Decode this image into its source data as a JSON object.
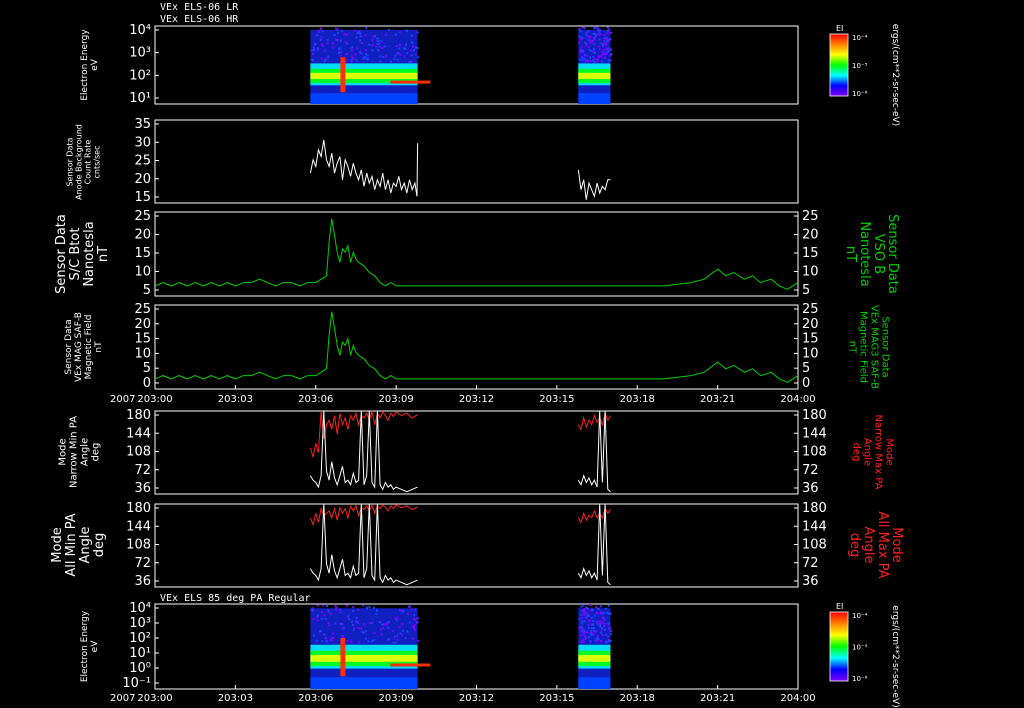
{
  "header": {
    "line1": "VEx ELS-06 LR",
    "line2": "VEx ELS-06 HR",
    "panel7_title": "VEx ELS 85 deg PA Regular"
  },
  "colorbar": {
    "label": "EI",
    "ticks": [
      "10⁻⁴",
      "10⁻⁵",
      "10⁻⁶"
    ],
    "units": "ergs/(cm**2-sr-sec-eV)",
    "colors": [
      "#ff0000",
      "#ff8000",
      "#ffff00",
      "#00ff00",
      "#00ffff",
      "#0000ff",
      "#8000ff"
    ]
  },
  "time_axis": {
    "year": "2007",
    "ticks": [
      "203:00",
      "203:03",
      "203:06",
      "203:09",
      "203:12",
      "203:15",
      "203:18",
      "203:21",
      "204:00"
    ]
  },
  "colors": {
    "green": "#00d000",
    "red": "#ff2020",
    "white": "#ffffff",
    "frame": "#ffffff"
  },
  "chart_data": [
    {
      "type": "heatmap",
      "ylabel": "Electron Energy eV",
      "yticks": [
        "10⁴",
        "10³",
        "10²",
        "10¹"
      ],
      "data_intervals": [
        [
          "203:05:48",
          "203:09:48"
        ],
        [
          "203:15:48",
          "203:17:00"
        ]
      ]
    },
    {
      "type": "line",
      "ylabel": "Sensor Data Anode Background Count Rate cnts/sec",
      "yticks": [
        "35",
        "30",
        "25",
        "20",
        "15"
      ],
      "ylim": [
        10,
        35
      ],
      "series": [
        {
          "color": "white",
          "x": [
            5.8,
            5.9,
            6.0,
            6.1,
            6.2,
            6.3,
            6.4,
            6.5,
            6.6,
            6.7,
            6.8,
            6.9,
            7.0,
            7.1,
            7.2,
            7.3,
            7.4,
            7.5,
            7.6,
            7.7,
            7.8,
            7.9,
            8.0,
            8.1,
            8.2,
            8.3,
            8.4,
            8.5,
            8.6,
            8.7,
            8.8,
            8.9,
            9.0,
            9.1,
            9.2,
            9.3,
            9.4,
            9.5,
            9.6,
            9.7,
            9.78,
            9.8
          ],
          "y": [
            19,
            23,
            21,
            26,
            24,
            29,
            23,
            21,
            25,
            19,
            22,
            24,
            17,
            23,
            21,
            18,
            22,
            19,
            17,
            20,
            15,
            19,
            16,
            18,
            14,
            17,
            15,
            19,
            14,
            17,
            13,
            16,
            15,
            18,
            14,
            16,
            13,
            17,
            14,
            16,
            12,
            28
          ]
        },
        {
          "color": "white",
          "x": [
            15.8,
            15.9,
            16.0,
            16.1,
            16.2,
            16.3,
            16.4,
            16.5,
            16.6,
            16.7,
            16.8,
            16.9,
            17.0
          ],
          "y": [
            20,
            14,
            17,
            11,
            16,
            14,
            12,
            16,
            13,
            15,
            14,
            17,
            17
          ]
        }
      ]
    },
    {
      "type": "line",
      "ylabel": "Sensor Data S/C Btot Nanotesla nT",
      "ylabel_right": "Sensor Data VSO B Nanotesla nT",
      "yticks": [
        "25",
        "20",
        "15",
        "10",
        "5"
      ],
      "ylim": [
        0,
        25
      ],
      "series": [
        {
          "color": "green",
          "x": [
            0,
            0.3,
            0.6,
            0.9,
            1.2,
            1.5,
            1.8,
            2.1,
            2.4,
            2.7,
            3.0,
            3.3,
            3.6,
            3.9,
            4.2,
            4.5,
            4.8,
            5.1,
            5.4,
            5.7,
            6.0,
            6.2,
            6.4,
            6.5,
            6.6,
            6.7,
            6.8,
            6.9,
            7.0,
            7.1,
            7.2,
            7.3,
            7.4,
            7.5,
            7.6,
            7.8,
            8.0,
            8.2,
            8.4,
            8.6,
            8.8,
            9.0,
            9.5,
            10,
            11,
            12,
            13,
            14,
            15,
            16,
            17,
            18,
            19,
            20,
            20.5,
            21,
            21.3,
            21.6,
            22,
            22.3,
            22.6,
            23,
            23.3,
            23.6,
            24
          ],
          "y": [
            3,
            4,
            3,
            4,
            3,
            4,
            3,
            4,
            3,
            4,
            3,
            4,
            4,
            5,
            4,
            3,
            4,
            4,
            3,
            4,
            4,
            5,
            6,
            16,
            23,
            18,
            13,
            10,
            14,
            13,
            15,
            10,
            13,
            11,
            10,
            9,
            7,
            6,
            4,
            3,
            4,
            3,
            3,
            3,
            3,
            3,
            3,
            3,
            3,
            3,
            3,
            3,
            3,
            4,
            5,
            8,
            6,
            7,
            5,
            6,
            4,
            5,
            3,
            2,
            4
          ]
        }
      ]
    },
    {
      "type": "line",
      "ylabel": "Sensor Data VEx MAG SAF-B Magnetic Field nT",
      "ylabel_right": "Sensor Data VEx MAG3 SAF-B Magnetic Field nT",
      "yticks": [
        "25",
        "20",
        "15",
        "10",
        "5",
        "0"
      ],
      "ylim": [
        0,
        25
      ],
      "series": [
        {
          "color": "green",
          "x": [
            0,
            0.3,
            0.6,
            0.9,
            1.2,
            1.5,
            1.8,
            2.1,
            2.4,
            2.7,
            3.0,
            3.3,
            3.6,
            3.9,
            4.2,
            4.5,
            4.8,
            5.1,
            5.4,
            5.7,
            6.0,
            6.2,
            6.4,
            6.5,
            6.6,
            6.7,
            6.8,
            6.9,
            7.0,
            7.1,
            7.2,
            7.3,
            7.4,
            7.5,
            7.6,
            7.8,
            8.0,
            8.2,
            8.4,
            8.6,
            8.8,
            9.0,
            9.5,
            10,
            11,
            12,
            13,
            14,
            15,
            16,
            17,
            18,
            19,
            20,
            20.5,
            21,
            21.3,
            21.6,
            22,
            22.3,
            22.6,
            23,
            23.3,
            23.6,
            24
          ],
          "y": [
            3,
            4,
            3,
            4,
            3,
            4,
            3,
            4,
            3,
            4,
            3,
            4,
            4,
            5,
            4,
            3,
            4,
            4,
            3,
            4,
            4,
            5,
            6,
            16,
            23,
            18,
            13,
            10,
            14,
            13,
            15,
            10,
            13,
            11,
            10,
            9,
            7,
            6,
            4,
            3,
            4,
            3,
            3,
            3,
            3,
            3,
            3,
            3,
            3,
            3,
            3,
            3,
            3,
            4,
            5,
            8,
            6,
            7,
            5,
            6,
            4,
            5,
            3,
            2,
            4
          ]
        }
      ]
    },
    {
      "type": "line",
      "ylabel": "Mode Narrow Min PA Angle deg",
      "ylabel_right": "Mode Narrow Max PA Angle deg",
      "yticks": [
        "180",
        "144",
        "108",
        "72",
        "36"
      ],
      "ylim": [
        0,
        180
      ],
      "series": [
        {
          "color": "red",
          "x": [
            5.8,
            5.9,
            6.0,
            6.1,
            6.2,
            6.3,
            6.4,
            6.5,
            6.6,
            6.7,
            6.8,
            6.9,
            7.0,
            7.1,
            7.2,
            7.3,
            7.4,
            7.5,
            7.6,
            7.7,
            7.8,
            7.9,
            8.0,
            8.1,
            8.2,
            8.3,
            8.4,
            8.5,
            8.6,
            8.7,
            8.8,
            8.9,
            9.0,
            9.2,
            9.4,
            9.6,
            9.8
          ],
          "y": [
            100,
            80,
            110,
            90,
            180,
            120,
            150,
            160,
            140,
            170,
            130,
            175,
            150,
            165,
            140,
            170,
            160,
            175,
            150,
            170,
            165,
            175,
            160,
            178,
            150,
            175,
            165,
            178,
            170,
            160,
            175,
            168,
            178,
            170,
            175,
            165,
            172
          ]
        },
        {
          "color": "white",
          "x": [
            5.8,
            5.9,
            6.0,
            6.1,
            6.2,
            6.3,
            6.4,
            6.5,
            6.6,
            6.7,
            6.8,
            6.9,
            7.0,
            7.1,
            7.2,
            7.3,
            7.4,
            7.5,
            7.6,
            7.7,
            7.8,
            7.9,
            8.0,
            8.1,
            8.2,
            8.3,
            8.4,
            8.5,
            8.6,
            8.7,
            8.8,
            8.9,
            9.0,
            9.2,
            9.4,
            9.6,
            9.8
          ],
          "y": [
            40,
            30,
            25,
            15,
            40,
            180,
            50,
            30,
            70,
            35,
            20,
            40,
            60,
            25,
            30,
            20,
            45,
            25,
            30,
            180,
            20,
            40,
            180,
            25,
            15,
            180,
            20,
            10,
            25,
            15,
            20,
            10,
            15,
            10,
            5,
            10,
            15
          ]
        },
        {
          "color": "red",
          "x": [
            15.8,
            15.9,
            16.0,
            16.1,
            16.2,
            16.3,
            16.4,
            16.5,
            16.6,
            16.7,
            16.8,
            16.9,
            17.0
          ],
          "y": [
            150,
            140,
            165,
            145,
            160,
            150,
            170,
            155,
            165,
            150,
            175,
            160,
            170
          ]
        },
        {
          "color": "white",
          "x": [
            15.8,
            15.9,
            16.0,
            16.1,
            16.2,
            16.3,
            16.4,
            16.5,
            16.6,
            16.7,
            16.8,
            16.9,
            17.0
          ],
          "y": [
            30,
            20,
            40,
            25,
            35,
            20,
            30,
            15,
            180,
            25,
            180,
            10,
            5
          ]
        }
      ]
    },
    {
      "type": "line",
      "ylabel": "Mode All Min PA Angle deg",
      "ylabel_right": "Mode All Max PA Angle deg",
      "yticks": [
        "180",
        "144",
        "108",
        "72",
        "36"
      ],
      "ylim": [
        0,
        180
      ],
      "series": [
        {
          "color": "red",
          "x": [
            5.8,
            5.9,
            6.0,
            6.1,
            6.2,
            6.3,
            6.4,
            6.5,
            6.6,
            6.7,
            6.8,
            6.9,
            7.0,
            7.1,
            7.2,
            7.3,
            7.4,
            7.5,
            7.6,
            7.7,
            7.8,
            7.9,
            8.0,
            8.1,
            8.2,
            8.3,
            8.4,
            8.5,
            8.6,
            8.7,
            8.8,
            8.9,
            9.0,
            9.2,
            9.4,
            9.6,
            9.8
          ],
          "y": [
            150,
            135,
            160,
            140,
            170,
            155,
            160,
            165,
            150,
            170,
            145,
            172,
            160,
            170,
            150,
            175,
            165,
            176,
            155,
            172,
            168,
            176,
            165,
            178,
            160,
            176,
            170,
            178,
            172,
            165,
            176,
            170,
            178,
            172,
            176,
            168,
            174
          ]
        },
        {
          "color": "white",
          "x": [
            5.8,
            5.9,
            6.0,
            6.1,
            6.2,
            6.3,
            6.4,
            6.5,
            6.6,
            6.7,
            6.8,
            6.9,
            7.0,
            7.1,
            7.2,
            7.3,
            7.4,
            7.5,
            7.6,
            7.7,
            7.8,
            7.9,
            8.0,
            8.1,
            8.2,
            8.3,
            8.4,
            8.5,
            8.6,
            8.7,
            8.8,
            8.9,
            9.0,
            9.2,
            9.4,
            9.6,
            9.8
          ],
          "y": [
            40,
            30,
            25,
            15,
            40,
            180,
            50,
            30,
            70,
            35,
            20,
            40,
            60,
            25,
            30,
            20,
            45,
            25,
            30,
            180,
            20,
            40,
            180,
            25,
            15,
            180,
            20,
            10,
            25,
            15,
            20,
            10,
            15,
            10,
            5,
            10,
            15
          ]
        },
        {
          "color": "red",
          "x": [
            15.8,
            15.9,
            16.0,
            16.1,
            16.2,
            16.3,
            16.4,
            16.5,
            16.6,
            16.7,
            16.8,
            16.9,
            17.0
          ],
          "y": [
            150,
            140,
            160,
            145,
            155,
            150,
            165,
            150,
            160,
            150,
            170,
            160,
            168
          ]
        },
        {
          "color": "white",
          "x": [
            15.8,
            15.9,
            16.0,
            16.1,
            16.2,
            16.3,
            16.4,
            16.5,
            16.6,
            16.7,
            16.8,
            16.9,
            17.0
          ],
          "y": [
            30,
            20,
            40,
            25,
            35,
            20,
            30,
            15,
            180,
            25,
            180,
            10,
            5
          ]
        }
      ]
    },
    {
      "type": "heatmap",
      "ylabel": "Electron Energy eV",
      "yticks": [
        "10⁴",
        "10³",
        "10²",
        "10¹",
        "10⁰",
        "10⁻¹"
      ],
      "data_intervals": [
        [
          "203:05:48",
          "203:09:48"
        ],
        [
          "203:15:48",
          "203:17:00"
        ]
      ]
    }
  ]
}
